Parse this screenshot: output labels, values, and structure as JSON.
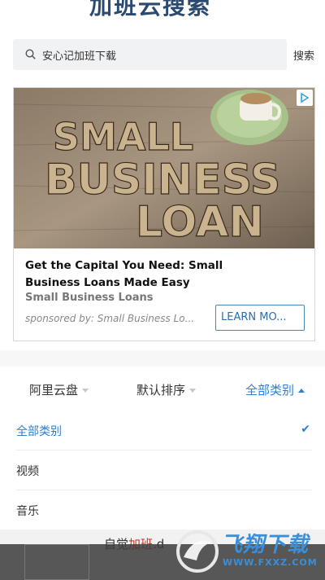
{
  "header": {
    "title": "加班云搜索"
  },
  "search": {
    "query": "安心记加班下载",
    "button_label": "搜索"
  },
  "ad": {
    "image_text": [
      "SMALL",
      "BUSINESS",
      "LOAN"
    ],
    "headline": "Get the Capital You Need: Small Business Loans Made Easy",
    "subhead": "Small Business Loans",
    "sponsor": "sponsored by: Small Business Lo...",
    "cta_label": "LEARN MO..."
  },
  "filters": [
    {
      "label": "阿里云盘",
      "active": false
    },
    {
      "label": "默认排序",
      "active": false
    },
    {
      "label": "全部类别",
      "active": true
    }
  ],
  "dropdown": {
    "items": [
      {
        "label": "全部类别",
        "selected": true
      },
      {
        "label": "视频",
        "selected": false
      },
      {
        "label": "音乐",
        "selected": false
      }
    ]
  },
  "result_preview": {
    "text_plain": "自觉",
    "text_highlight": "加班",
    "text_tail": ".d"
  },
  "watermark": {
    "brand": "飞翔下载",
    "url": "WWW.FXXZ.COM"
  },
  "colors": {
    "accent": "#2d7fd1",
    "title": "#2b4a70",
    "brand": "#3a8fd9"
  }
}
